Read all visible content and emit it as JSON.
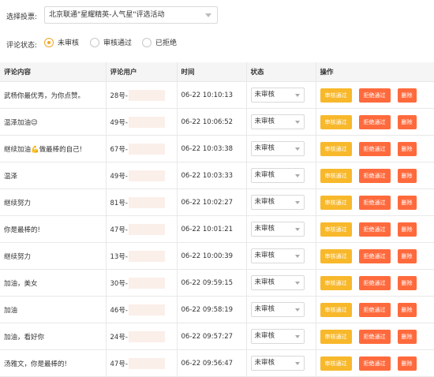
{
  "filter": {
    "vote_label": "选择投票:",
    "vote_value": "北京联通\"星耀精英-人气星\"评选活动",
    "status_label": "评论状态:",
    "status_options": [
      {
        "label": "未审核",
        "selected": true
      },
      {
        "label": "审核通过",
        "selected": false
      },
      {
        "label": "已拒绝",
        "selected": false
      }
    ]
  },
  "table": {
    "headers": [
      "评论内容",
      "评论用户",
      "时间",
      "状态",
      "操作"
    ],
    "actions": {
      "pass": "审核通过",
      "reject": "拒绝通过",
      "delete": "删除"
    },
    "rows": [
      {
        "content": "武杨你最优秀，为你点赞。",
        "user": "28号-",
        "time": "06-22 10:10:13",
        "status": "未审核"
      },
      {
        "content": "温泽加油😉",
        "user": "49号-",
        "time": "06-22 10:06:52",
        "status": "未审核"
      },
      {
        "content": "继续加油💪做最棒的自己!",
        "user": "67号-",
        "time": "06-22 10:03:38",
        "status": "未审核"
      },
      {
        "content": "温泽",
        "user": "49号-",
        "time": "06-22 10:03:33",
        "status": "未审核"
      },
      {
        "content": "继续努力",
        "user": "81号-",
        "time": "06-22 10:02:27",
        "status": "未审核"
      },
      {
        "content": "你是最棒的!",
        "user": "47号-",
        "time": "06-22 10:01:21",
        "status": "未审核"
      },
      {
        "content": "继续努力",
        "user": "13号-",
        "time": "06-22 10:00:39",
        "status": "未审核"
      },
      {
        "content": "加油，美女",
        "user": "30号-",
        "time": "06-22 09:59:15",
        "status": "未审核"
      },
      {
        "content": "加油",
        "user": "46号-",
        "time": "06-22 09:58:19",
        "status": "未审核"
      },
      {
        "content": "加油，看好你",
        "user": "24号-",
        "time": "06-22 09:57:27",
        "status": "未审核"
      },
      {
        "content": "汤雅文，你是最棒的!",
        "user": "47号-",
        "time": "06-22 09:56:47",
        "status": "未审核"
      }
    ]
  }
}
